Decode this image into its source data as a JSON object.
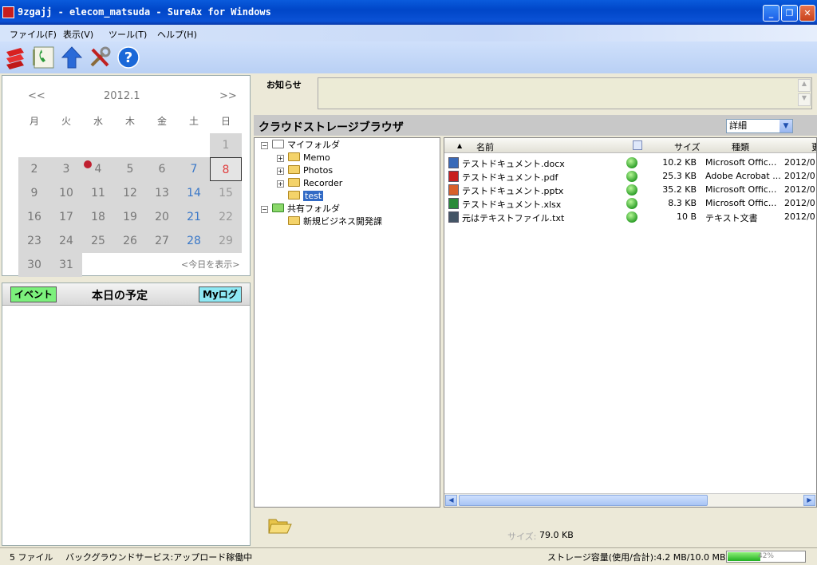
{
  "window": {
    "title": "9zgajj - elecom_matsuda - SureAx for Windows",
    "app_icon": "SureAx"
  },
  "menu": [
    "ファイル(F)",
    "表示(V)",
    "ツール(T)",
    "ヘルプ(H)"
  ],
  "toolbar": {
    "icons": [
      "sureax-logo-icon",
      "phonebook-icon",
      "upload-arrow-icon",
      "tools-icon",
      "help-icon"
    ]
  },
  "calendar": {
    "prev": "<<",
    "next": ">>",
    "month": "2012.1",
    "weekdays": [
      "月",
      "火",
      "水",
      "木",
      "金",
      "土",
      "日"
    ],
    "rows": [
      [
        "",
        "",
        "",
        "",
        "",
        "",
        "1"
      ],
      [
        "2",
        "3",
        "4",
        "5",
        "6",
        "7",
        "8"
      ],
      [
        "9",
        "10",
        "11",
        "12",
        "13",
        "14",
        "15"
      ],
      [
        "16",
        "17",
        "18",
        "19",
        "20",
        "21",
        "22"
      ],
      [
        "23",
        "24",
        "25",
        "26",
        "27",
        "28",
        "29"
      ],
      [
        "30",
        "31",
        "",
        "",
        "",
        "",
        ""
      ]
    ],
    "today_link": "<今日を表示>"
  },
  "schedule": {
    "event_button": "イベント",
    "title": "本日の予定",
    "mylog_button": "Myログ"
  },
  "notice": {
    "label": "お知らせ"
  },
  "cloud": {
    "title": "クラウドストレージブラウザ",
    "view_mode": "詳細"
  },
  "tree": {
    "my_folder": "マイフォルダ",
    "children": [
      "Memo",
      "Photos",
      "Recorder",
      "test"
    ],
    "shared_folder": "共有フォルダ",
    "shared_children": [
      "新規ビジネス開発課"
    ]
  },
  "files": {
    "headers": {
      "name": "名前",
      "size": "サイズ",
      "type": "種類",
      "date": "更"
    },
    "rows": [
      {
        "name": "テストドキュメント.docx",
        "size": "10.2 KB",
        "type": "Microsoft Offic...",
        "date": "2012/0",
        "icon_color": "#3a6ab8"
      },
      {
        "name": "テストドキュメント.pdf",
        "size": "25.3 KB",
        "type": "Adobe Acrobat ...",
        "date": "2012/0",
        "icon_color": "#c82020"
      },
      {
        "name": "テストドキュメント.pptx",
        "size": "35.2 KB",
        "type": "Microsoft Offic...",
        "date": "2012/0",
        "icon_color": "#d8602a"
      },
      {
        "name": "テストドキュメント.xlsx",
        "size": "8.3 KB",
        "type": "Microsoft Offic...",
        "date": "2012/0",
        "icon_color": "#2a8a3a"
      },
      {
        "name": "元はテキストファイル.txt",
        "size": "10  B",
        "type": "テキスト文書",
        "date": "2012/0",
        "icon_color": "#445566"
      }
    ]
  },
  "footer": {
    "size_label": "サイズ:",
    "size_value": "79.0 KB"
  },
  "status": {
    "file_count": "5 ファイル",
    "service": "バックグラウンドサービス:アップロード稼働中",
    "storage": "ストレージ容量(使用/合計):4.2 MB/10.0 MB",
    "usage_percent": 42,
    "usage_label": "42%"
  }
}
